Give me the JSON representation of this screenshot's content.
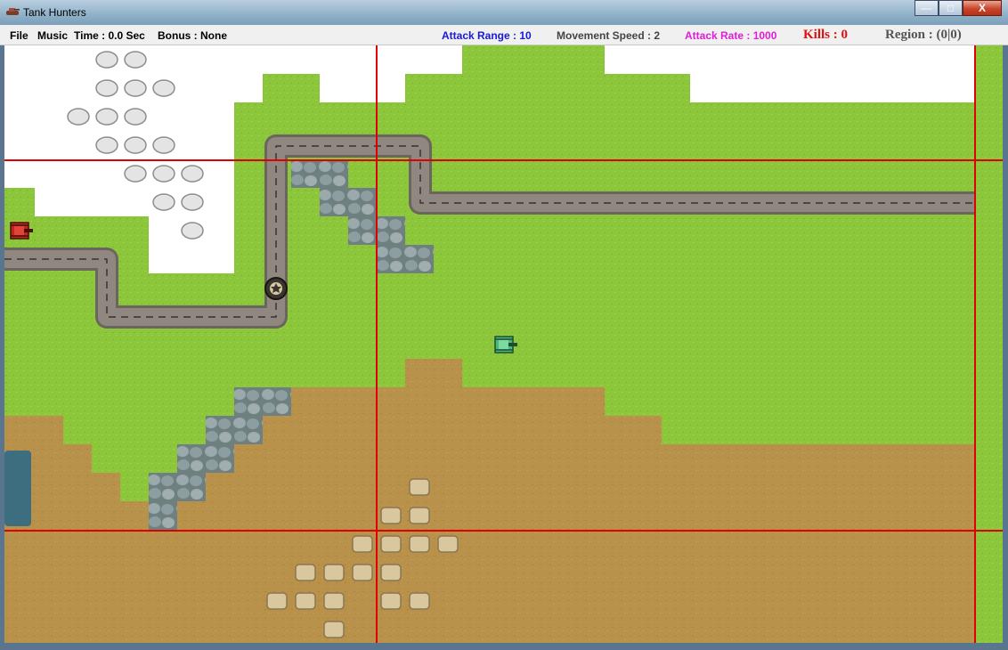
{
  "window": {
    "title": "Tank Hunters",
    "buttons": {
      "minimize": "—",
      "maximize": "□",
      "close": "X"
    }
  },
  "menu": {
    "file": "File",
    "music": "Music",
    "time": "Time : 0.0 Sec",
    "bonus": "Bonus : None"
  },
  "stats": {
    "attack_range": "Attack Range : 10",
    "movement_speed": "Movement Speed : 2",
    "attack_rate": "Attack Rate : 1000",
    "kills": "Kills : 0",
    "region": "Region : (0|0)"
  },
  "colors": {
    "grass": "#8cc63a",
    "dirt": "#b8914a",
    "snow": "#ffffff",
    "road": "#8f8780",
    "stone": "#8a9aa0",
    "gridline": "#e00000",
    "stat_range": "#1a1ad6",
    "stat_rate": "#e01ed8",
    "stat_kills": "#e01010"
  },
  "map": {
    "terrain_types": [
      "snow",
      "grass",
      "dirt",
      "stone",
      "road"
    ],
    "objects": [
      "player-tank",
      "enemy-tank",
      "base-turret",
      "snow-rocks",
      "sand-rocks"
    ]
  }
}
